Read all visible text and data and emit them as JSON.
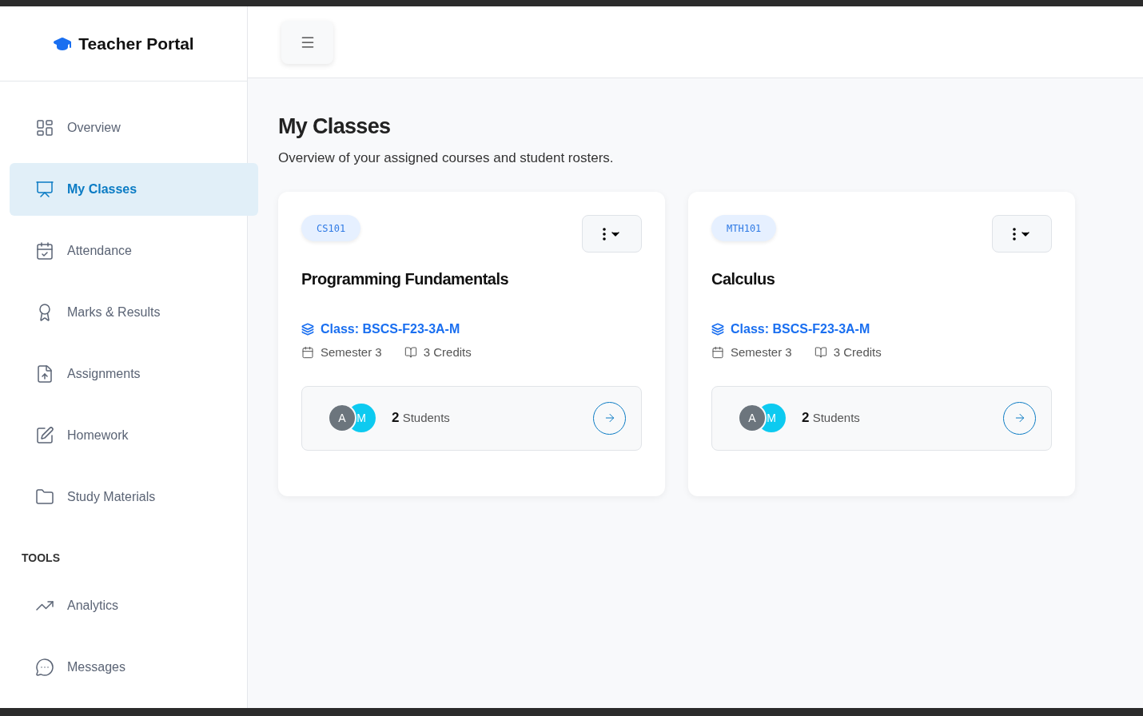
{
  "brand": {
    "title": "Teacher Portal"
  },
  "nav": [
    {
      "label": "Overview",
      "selected": false
    },
    {
      "label": "My Classes",
      "selected": true
    },
    {
      "label": "Attendance",
      "selected": false
    },
    {
      "label": "Marks & Results",
      "selected": false
    },
    {
      "label": "Assignments",
      "selected": false
    },
    {
      "label": "Homework",
      "selected": false
    },
    {
      "label": "Study Materials",
      "selected": false
    }
  ],
  "tools_heading": "TOOLS",
  "tools": [
    {
      "label": "Analytics",
      "selected": false
    },
    {
      "label": "Messages",
      "selected": false
    }
  ],
  "page": {
    "title": "My Classes",
    "subtitle": "Overview of your assigned courses and student rosters."
  },
  "classes": [
    {
      "code": "CS101",
      "name": "Programming Fundamentals",
      "class_label": "Class: BSCS-F23-3A-M",
      "semester": "Semester 3",
      "credits": "3 Credits",
      "avatars": [
        {
          "initial": "A",
          "color": "#6c757d"
        },
        {
          "initial": "M",
          "color": "#0dcaf0"
        }
      ],
      "student_count": "2",
      "students_label": "Students"
    },
    {
      "code": "MTH101",
      "name": "Calculus",
      "class_label": "Class: BSCS-F23-3A-M",
      "semester": "Semester 3",
      "credits": "3 Credits",
      "avatars": [
        {
          "initial": "A",
          "color": "#6c757d"
        },
        {
          "initial": "M",
          "color": "#0dcaf0"
        }
      ],
      "student_count": "2",
      "students_label": "Students"
    }
  ]
}
